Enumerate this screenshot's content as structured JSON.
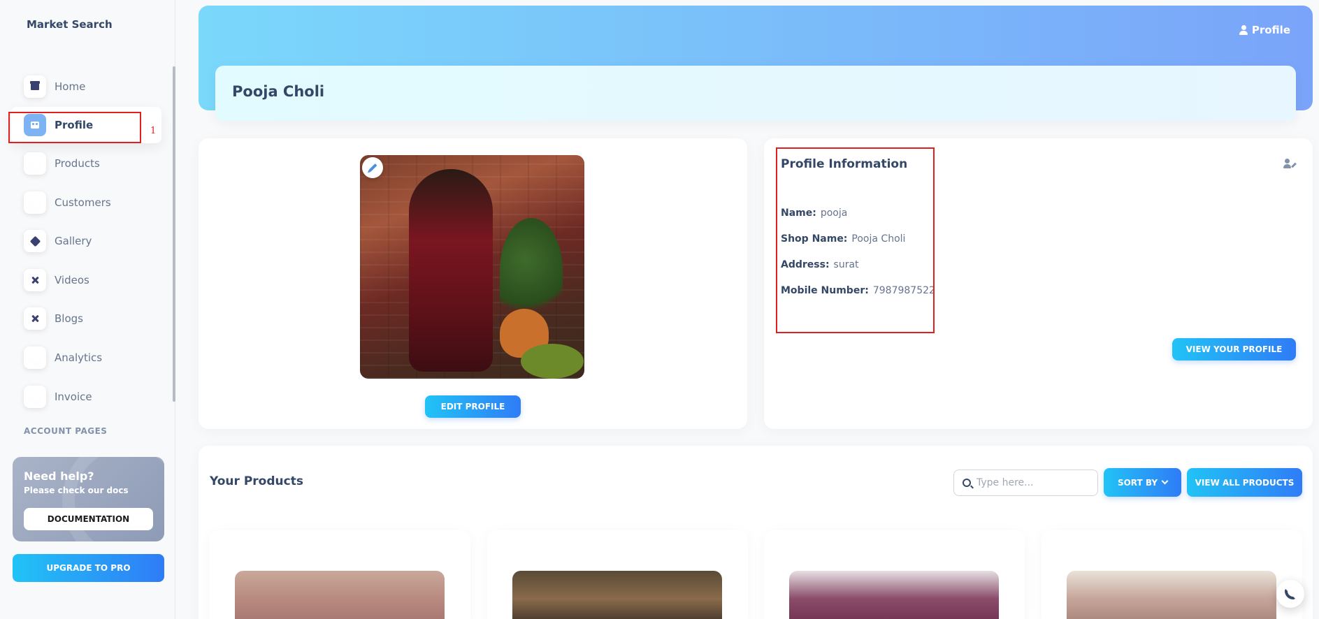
{
  "sidebar": {
    "brand": "Market Search",
    "items": [
      {
        "label": "Home",
        "icon": "store-icon"
      },
      {
        "label": "Profile",
        "icon": "building-icon"
      },
      {
        "label": "Products",
        "icon": "credit-card-icon"
      },
      {
        "label": "Customers",
        "icon": "credit-card-icon"
      },
      {
        "label": "Gallery",
        "icon": "box-icon"
      },
      {
        "label": "Videos",
        "icon": "tools-icon"
      },
      {
        "label": "Blogs",
        "icon": "tools-icon"
      },
      {
        "label": "Analytics",
        "icon": "credit-card-icon"
      },
      {
        "label": "Invoice",
        "icon": "credit-card-icon"
      }
    ],
    "section_heading": "ACCOUNT PAGES",
    "annotation_number": "1",
    "help": {
      "title": "Need help?",
      "subtitle": "Please check our docs",
      "button": "DOCUMENTATION"
    },
    "upgrade_button": "UPGRADE TO PRO"
  },
  "header": {
    "profile_link": "Profile",
    "shop_name": "Pooja Choli"
  },
  "profile_card": {
    "edit_button": "EDIT PROFILE"
  },
  "profile_info": {
    "title": "Profile Information",
    "fields": [
      {
        "label": "Name:",
        "value": "pooja"
      },
      {
        "label": "Shop Name:",
        "value": "Pooja Choli"
      },
      {
        "label": "Address:",
        "value": "surat"
      },
      {
        "label": "Mobile Number:",
        "value": "7987987522"
      }
    ],
    "view_button": "VIEW YOUR PROFILE"
  },
  "products": {
    "title": "Your Products",
    "search_placeholder": "Type here...",
    "sort_button": "SORT BY",
    "view_all_button": "VIEW ALL PRODUCTS"
  },
  "colors": {
    "accent_start": "#21c3f6",
    "accent_end": "#2f7cf6",
    "text_primary": "#344767",
    "text_secondary": "#67748e",
    "annotation_red": "#e02020"
  }
}
